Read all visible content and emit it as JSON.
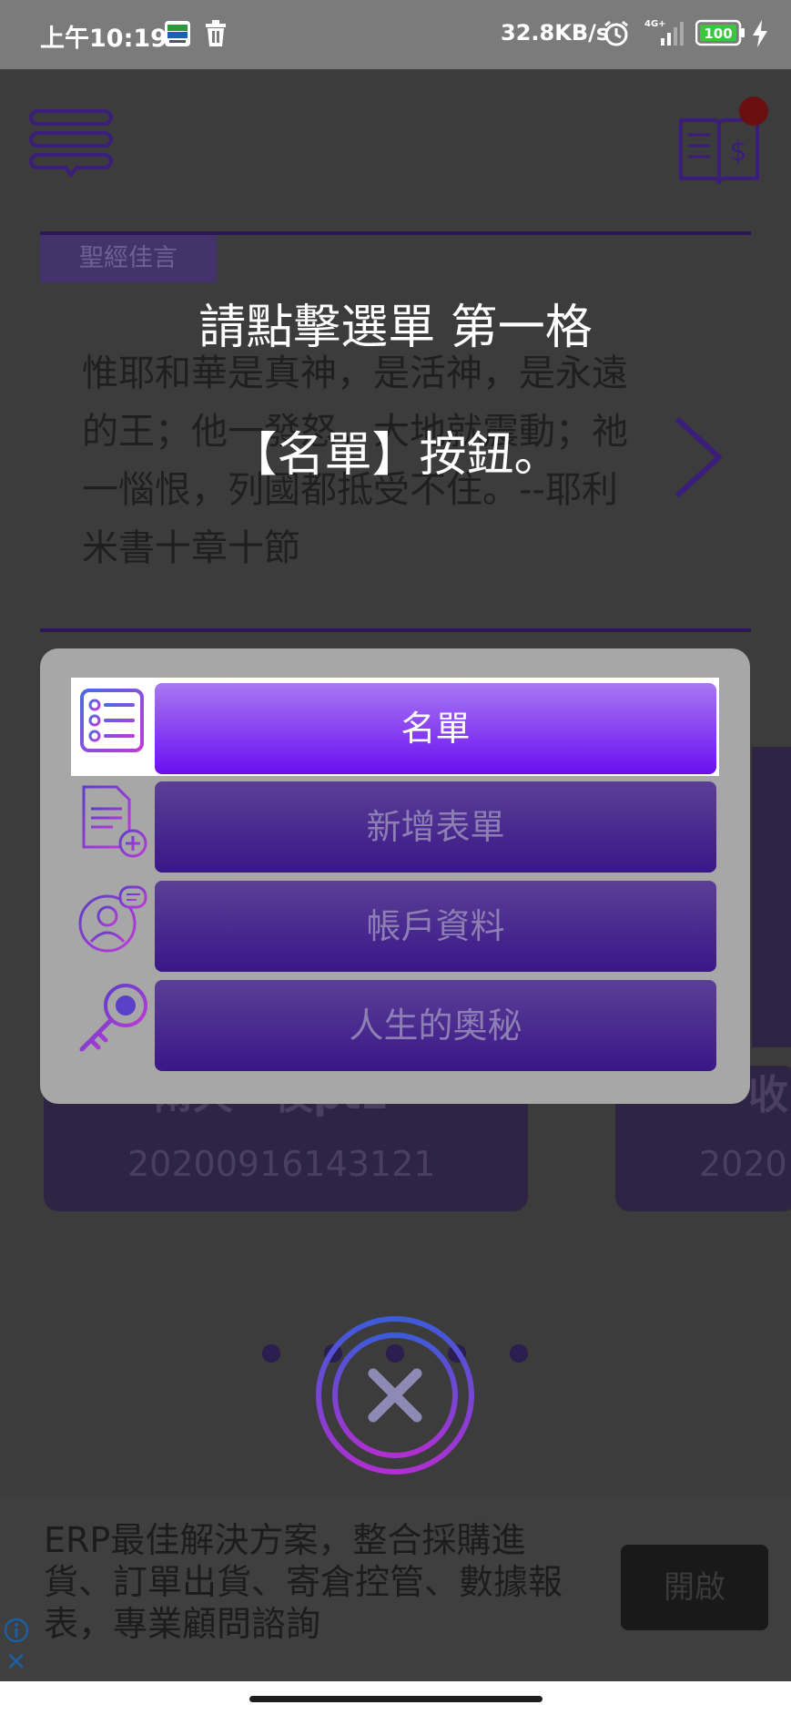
{
  "status_bar": {
    "time": "上午10:19",
    "network_speed": "32.8KB/s",
    "network_type": "4G+",
    "battery": "100"
  },
  "header": {
    "menu_icon": "hamburger-menu-icon",
    "book_icon": "ledger-book-icon"
  },
  "verse": {
    "tag": "聖經佳言",
    "text": "惟耶和華是真神，是活神，是永遠的王；他一發怒，大地就震動；祂一惱恨，列國都抵受不住。--耶利米書十章十節"
  },
  "cards": [
    {
      "title": "兩天一夜pt2",
      "number": "20200916143121"
    },
    {
      "title": "收",
      "number": "2020"
    }
  ],
  "instruction": {
    "line1": "請點擊選單 第一格",
    "line2": "【名單】按鈕。"
  },
  "menu": {
    "items": [
      {
        "label": "名單",
        "icon": "list-icon",
        "active": true
      },
      {
        "label": "新增表單",
        "icon": "add-document-icon",
        "active": false
      },
      {
        "label": "帳戶資料",
        "icon": "account-icon",
        "active": false
      },
      {
        "label": "人生的奧秘",
        "icon": "key-icon",
        "active": false
      }
    ]
  },
  "pagination": {
    "pages": 5
  },
  "ad": {
    "text": "ERP最佳解決方案，整合採購進貨、訂單出貨、寄倉控管、數據報表，專業顧問諮詢",
    "button": "開啟"
  },
  "colors": {
    "accent_purple": "#6b0ff0",
    "overlay_dark": "#3c3c3c",
    "panel_gray": "#a7a7a7"
  }
}
